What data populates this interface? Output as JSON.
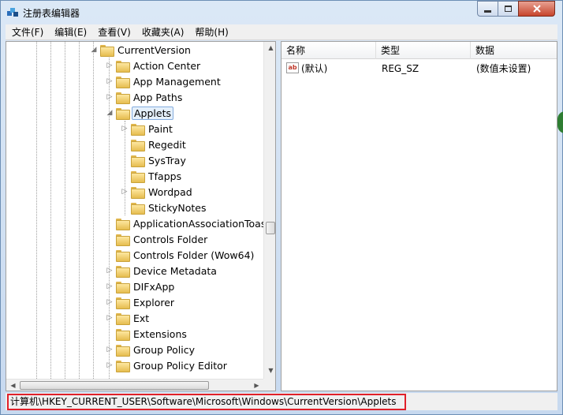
{
  "window": {
    "title": "注册表编辑器"
  },
  "menu": [
    "文件(F)",
    "编辑(E)",
    "查看(V)",
    "收藏夹(A)",
    "帮助(H)"
  ],
  "tree": {
    "root": "CurrentVersion",
    "items": [
      {
        "label": "Action Center"
      },
      {
        "label": "App Management"
      },
      {
        "label": "App Paths"
      },
      {
        "label": "Applets",
        "selected": true
      },
      {
        "label": "Paint"
      },
      {
        "label": "Regedit"
      },
      {
        "label": "SysTray"
      },
      {
        "label": "Tfapps"
      },
      {
        "label": "Wordpad"
      },
      {
        "label": "StickyNotes"
      },
      {
        "label": "ApplicationAssociationToasts"
      },
      {
        "label": "Controls Folder"
      },
      {
        "label": "Controls Folder (Wow64)"
      },
      {
        "label": "Device Metadata"
      },
      {
        "label": "DIFxApp"
      },
      {
        "label": "Explorer"
      },
      {
        "label": "Ext"
      },
      {
        "label": "Extensions"
      },
      {
        "label": "Group Policy"
      },
      {
        "label": "Group Policy Editor"
      }
    ]
  },
  "list": {
    "headers": {
      "name": "名称",
      "type": "类型",
      "data": "数据"
    },
    "rows": [
      {
        "icon": "ab",
        "name": "(默认)",
        "type": "REG_SZ",
        "data": "(数值未设置)"
      }
    ]
  },
  "status": {
    "path": "计算机\\HKEY_CURRENT_USER\\Software\\Microsoft\\Windows\\CurrentVersion\\Applets"
  }
}
